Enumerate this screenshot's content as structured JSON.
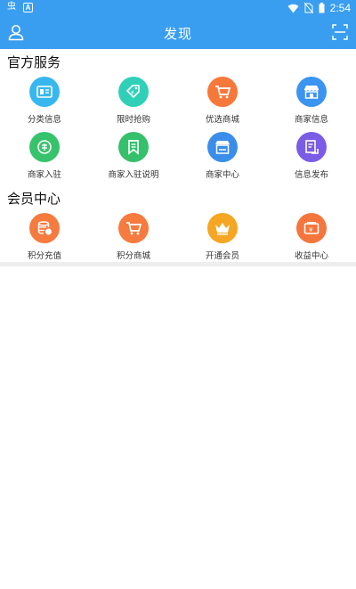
{
  "statusbar": {
    "time": "2:54",
    "left_icon_1": "虫",
    "left_icon_2": "A"
  },
  "header": {
    "title": "发现"
  },
  "official": {
    "title": "官方服务",
    "items": [
      {
        "label": "分类信息",
        "color": "#38b7ee",
        "icon": "category-icon"
      },
      {
        "label": "限时抢购",
        "color": "#30d0b8",
        "icon": "tag-icon"
      },
      {
        "label": "优选商城",
        "color": "#f7783b",
        "icon": "cart-icon"
      },
      {
        "label": "商家信息",
        "color": "#3a94f0",
        "icon": "store-icon"
      },
      {
        "label": "商家入驻",
        "color": "#36c36c",
        "icon": "join-icon"
      },
      {
        "label": "商家入驻说明",
        "color": "#35c06b",
        "icon": "bookmark-doc-icon"
      },
      {
        "label": "商家中心",
        "color": "#3a8eea",
        "icon": "shop-center-icon"
      },
      {
        "label": "信息发布",
        "color": "#7a5ce6",
        "icon": "publish-icon"
      }
    ]
  },
  "member": {
    "title": "会员中心",
    "items": [
      {
        "label": "积分充值",
        "color": "#f57b3e",
        "icon": "coins-icon"
      },
      {
        "label": "积分商城",
        "color": "#f57b3e",
        "icon": "cart-icon"
      },
      {
        "label": "开通会员",
        "color": "#f5a623",
        "icon": "crown-icon"
      },
      {
        "label": "收益中心",
        "color": "#f5763c",
        "icon": "wallet-icon"
      }
    ]
  }
}
